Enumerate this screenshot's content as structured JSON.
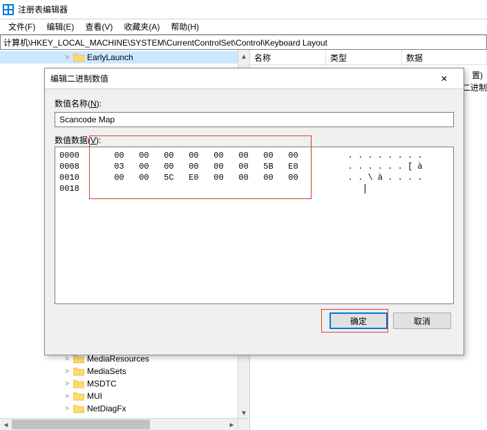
{
  "window": {
    "title": "注册表编辑器"
  },
  "menu": {
    "file": "文件(F)",
    "edit": "编辑(E)",
    "view": "查看(V)",
    "favorites": "收藏夹(A)",
    "help": "帮助(H)"
  },
  "addressbar": {
    "path": "计算机\\HKEY_LOCAL_MACHINE\\SYSTEM\\CurrentControlSet\\Control\\Keyboard Layout"
  },
  "tree": {
    "items": [
      {
        "label": "EarlyLaunch",
        "expander": ">",
        "selected": true
      },
      {
        "label": "MediaResources",
        "expander": ">"
      },
      {
        "label": "MediaSets",
        "expander": ">"
      },
      {
        "label": "MSDTC",
        "expander": ">"
      },
      {
        "label": "MUI",
        "expander": ">"
      },
      {
        "label": "NetDiagFx",
        "expander": ">"
      }
    ]
  },
  "list": {
    "columns": {
      "name": "名称",
      "type": "类型",
      "data": "数据"
    },
    "stray1": "置)",
    "stray2": "的二进制"
  },
  "dialog": {
    "title": "编辑二进制数值",
    "close_glyph": "✕",
    "name_label_pre": "数值名称(",
    "name_label_ul": "N",
    "name_label_post": "):",
    "name_value": "Scancode Map",
    "data_label_pre": "数值数据(",
    "data_label_ul": "V",
    "data_label_post": "):",
    "hex_rows": [
      {
        "off": "0000",
        "b": [
          "00",
          "00",
          "00",
          "00",
          "00",
          "00",
          "00",
          "00"
        ],
        "a": ". . . . . . . ."
      },
      {
        "off": "0008",
        "b": [
          "03",
          "00",
          "00",
          "00",
          "00",
          "00",
          "5B",
          "E0"
        ],
        "a": ". . . . . . [ à"
      },
      {
        "off": "0010",
        "b": [
          "00",
          "00",
          "5C",
          "E0",
          "00",
          "00",
          "00",
          "00"
        ],
        "a": ". . \\ à . . . ."
      },
      {
        "off": "0018",
        "b": [],
        "a": ""
      }
    ],
    "ok_label": "确定",
    "cancel_label": "取消"
  }
}
